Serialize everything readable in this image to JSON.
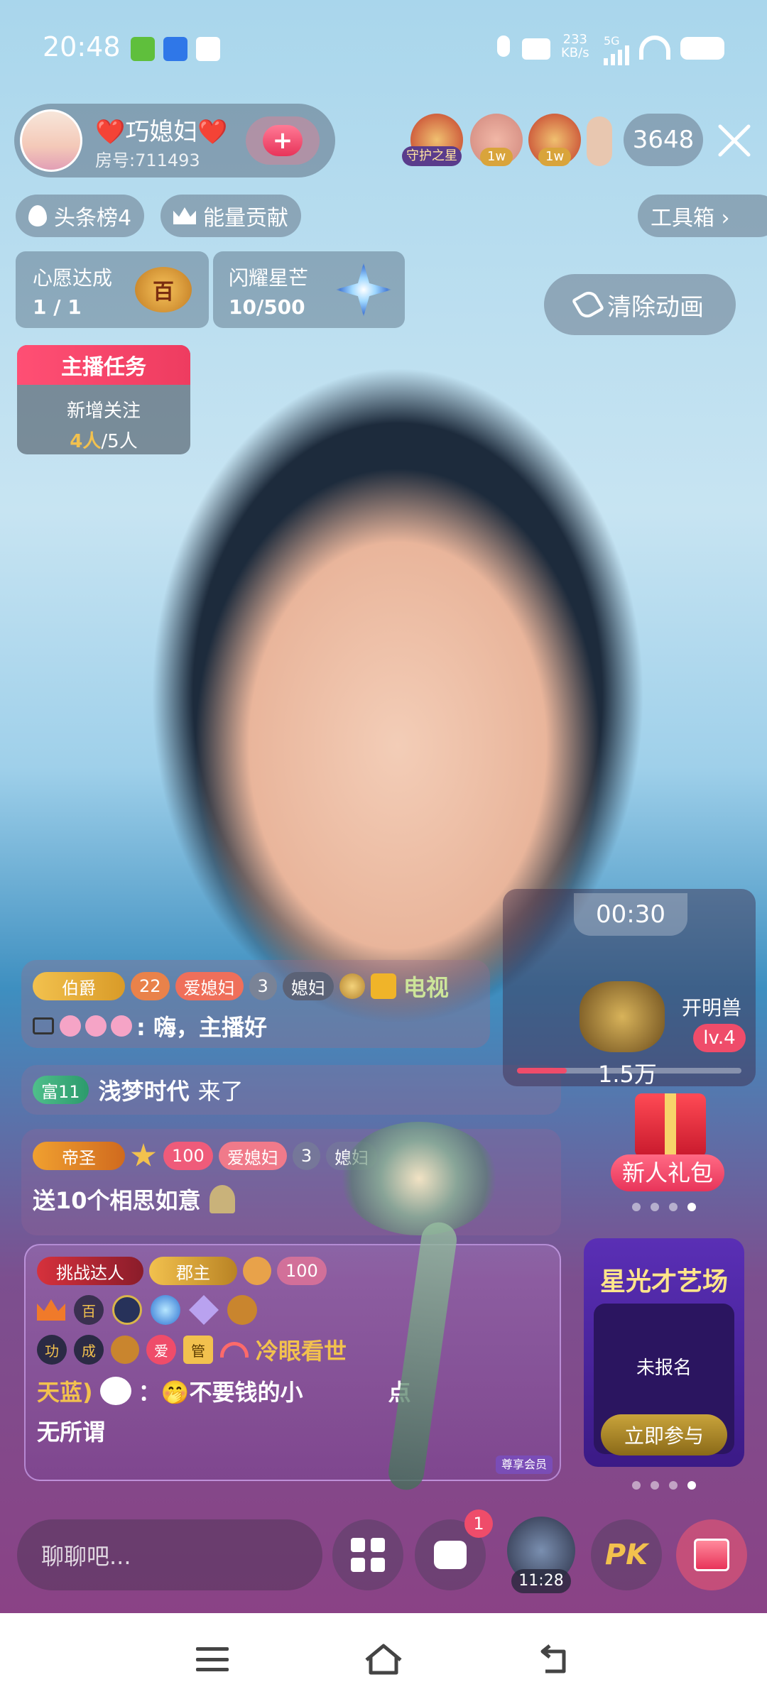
{
  "status_bar": {
    "time": "20:48",
    "net_speed_value": "233",
    "net_speed_unit": "KB/s",
    "network": "5G"
  },
  "host": {
    "name": "❤️巧媳妇❤️",
    "room_id": "房号:711493",
    "follow_symbol": "+"
  },
  "viewers": {
    "badge_1": "守护之星",
    "badge_2": "1w",
    "badge_3": "1w",
    "count": "3648"
  },
  "top_buttons": {
    "headline_rank": "头条榜4",
    "energy": "能量贡献",
    "toolbox": "工具箱 ›"
  },
  "progress_cards": {
    "wish": {
      "label": "心愿达成",
      "value": "1 / 1",
      "icon_text": "百"
    },
    "star": {
      "label": "闪耀星芒",
      "value": "10/500"
    }
  },
  "clear_anim": "清除动画",
  "task": {
    "header": "主播任务",
    "line1": "新增关注",
    "current": "4人",
    "total": "/5人"
  },
  "comments": {
    "c1": {
      "badges": [
        "伯爵",
        "22",
        "爱媳妇",
        "3",
        "媳妇"
      ],
      "name": "电视",
      "message": ": 嗨，主播好"
    },
    "c2": {
      "badge": "富11",
      "name": "浅梦时代",
      "action": "来了"
    },
    "c3": {
      "badges": [
        "帝圣",
        "100",
        "爱媳妇",
        "3",
        "媳妇"
      ],
      "message": "送10个相思如意"
    },
    "c4": {
      "badges": [
        "挑战达人",
        "郡主",
        "100"
      ],
      "small_badges": [
        "百",
        "功",
        "成",
        "爱",
        "管"
      ],
      "name": "冷眼看世",
      "name_tail": "天蓝)",
      "message": "：🤭不要钱的小",
      "message_tail": "点",
      "line3": "无所谓",
      "member": "尊享会员"
    }
  },
  "pk_panel": {
    "timer": "00:30",
    "beast": "开明兽",
    "level": "lv.4",
    "score": "1.5万"
  },
  "newbie_gift": "新人礼包",
  "talent": {
    "title": "星光才艺场",
    "status": "未报名",
    "join": "立即参与"
  },
  "bottom_bar": {
    "chat_placeholder": "聊聊吧...",
    "msg_badge": "1",
    "timer": "11:28",
    "pk_label": "PK"
  },
  "colors": {
    "accent_pink": "#ef4c6a",
    "gold": "#f2c14e",
    "green_name": "#cde59a"
  }
}
